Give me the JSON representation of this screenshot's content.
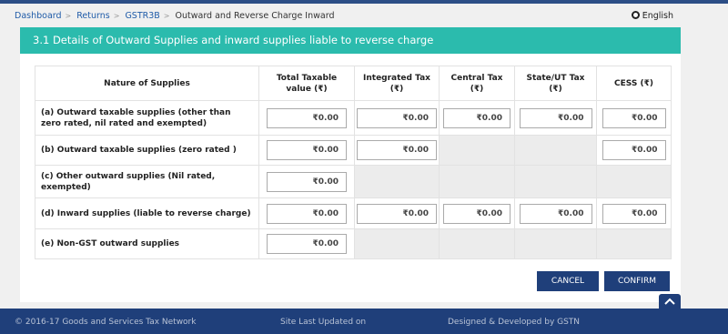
{
  "breadcrumb": {
    "items": [
      "Dashboard",
      "Returns",
      "GSTR3B"
    ],
    "current": "Outward and Reverse Charge Inward",
    "separator": ">"
  },
  "language": {
    "label": "English",
    "icon": "globe-icon"
  },
  "section": {
    "title": "3.1 Details of Outward Supplies and inward supplies liable to reverse charge"
  },
  "table": {
    "headers": [
      "Nature of Supplies",
      "Total Taxable value (₹)",
      "Integrated Tax (₹)",
      "Central Tax (₹)",
      "State/UT Tax (₹)",
      "CESS (₹)"
    ],
    "rows": [
      {
        "label": "(a) Outward taxable supplies (other than zero rated, nil rated and exempted)",
        "total": "₹0.00",
        "igst": "₹0.00",
        "cgst": "₹0.00",
        "sgst": "₹0.00",
        "cess": "₹0.00"
      },
      {
        "label": "(b) Outward taxable supplies (zero rated )",
        "total": "₹0.00",
        "igst": "₹0.00",
        "cess": "₹0.00"
      },
      {
        "label": "(c) Other outward supplies (Nil rated, exempted)",
        "total": "₹0.00"
      },
      {
        "label": "(d) Inward supplies (liable to reverse charge)",
        "total": "₹0.00",
        "igst": "₹0.00",
        "cgst": "₹0.00",
        "sgst": "₹0.00",
        "cess": "₹0.00"
      },
      {
        "label": "(e) Non-GST outward supplies",
        "total": "₹0.00"
      }
    ]
  },
  "actions": {
    "cancel": "CANCEL",
    "confirm": "CONFIRM"
  },
  "footer": {
    "copyright": "© 2016-17 Goods and Services Tax Network",
    "last_updated": "Site Last Updated on",
    "designed_by": "Designed & Developed by GSTN"
  },
  "colors": {
    "header_teal": "#2bbbad",
    "navy": "#1f3f7a",
    "disabled_cell": "#ececec"
  }
}
